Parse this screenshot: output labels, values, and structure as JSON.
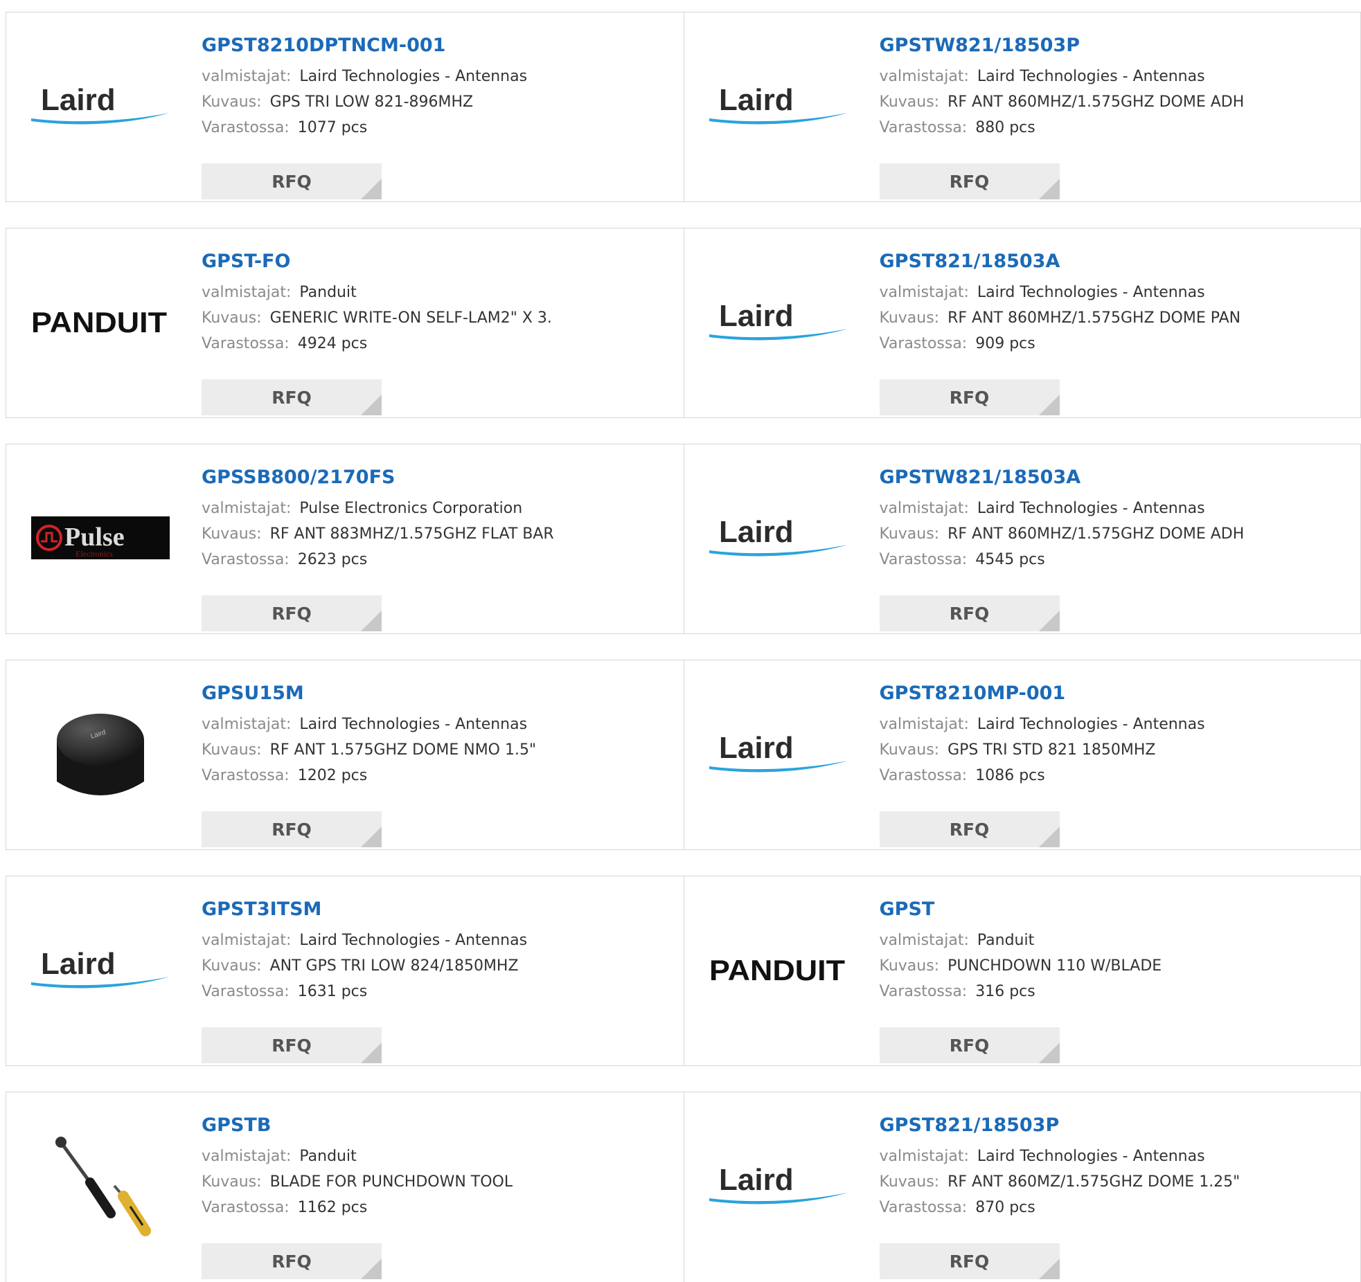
{
  "labels": {
    "manufacturer": "valmistajat:",
    "description": "Kuvaus:",
    "stock": "Varastossa:",
    "rfq": "RFQ"
  },
  "logo_text": {
    "laird": "Laird",
    "panduit": "PANDUIT",
    "pulse": "Pulse",
    "pulse_sub": "Electronics"
  },
  "colors": {
    "link": "#1b6ab8",
    "label": "#8a8a8a",
    "button_bg": "#ececec"
  },
  "products": [
    {
      "pn": "GPST8210DPTNCM-001",
      "logo": "laird-logo",
      "mfr": "Laird Technologies - Antennas",
      "desc": "GPS TRI LOW 821-896MHZ",
      "stock": "1077 pcs"
    },
    {
      "pn": "GPSTW821/18503P",
      "logo": "laird-logo",
      "mfr": "Laird Technologies - Antennas",
      "desc": "RF ANT 860MHZ/1.575GHZ DOME ADH",
      "stock": "880 pcs"
    },
    {
      "pn": "GPST-FO",
      "logo": "panduit-logo",
      "mfr": "Panduit",
      "desc": "GENERIC WRITE-ON SELF-LAM2\" X 3.",
      "stock": "4924 pcs"
    },
    {
      "pn": "GPST821/18503A",
      "logo": "laird-logo",
      "mfr": "Laird Technologies - Antennas",
      "desc": "RF ANT 860MHZ/1.575GHZ DOME PAN",
      "stock": "909 pcs"
    },
    {
      "pn": "GPSSB800/2170FS",
      "logo": "pulse-logo",
      "mfr": "Pulse Electronics Corporation",
      "desc": "RF ANT 883MHZ/1.575GHZ FLAT BAR",
      "stock": "2623 pcs"
    },
    {
      "pn": "GPSTW821/18503A",
      "logo": "laird-logo",
      "mfr": "Laird Technologies - Antennas",
      "desc": "RF ANT 860MHZ/1.575GHZ DOME ADH",
      "stock": "4545 pcs"
    },
    {
      "pn": "GPSU15M",
      "logo": "antenna-dome-photo",
      "mfr": "Laird Technologies - Antennas",
      "desc": "RF ANT 1.575GHZ DOME NMO 1.5\"",
      "stock": "1202 pcs"
    },
    {
      "pn": "GPST8210MP-001",
      "logo": "laird-logo",
      "mfr": "Laird Technologies - Antennas",
      "desc": "GPS TRI STD 821 1850MHZ",
      "stock": "1086 pcs"
    },
    {
      "pn": "GPST3ITSM",
      "logo": "laird-logo",
      "mfr": "Laird Technologies - Antennas",
      "desc": "ANT GPS TRI LOW 824/1850MHZ",
      "stock": "1631 pcs"
    },
    {
      "pn": "GPST",
      "logo": "panduit-logo",
      "mfr": "Panduit",
      "desc": "PUNCHDOWN 110 W/BLADE",
      "stock": "316 pcs"
    },
    {
      "pn": "GPSTB",
      "logo": "punchdown-tool-photo",
      "mfr": "Panduit",
      "desc": "BLADE FOR PUNCHDOWN TOOL",
      "stock": "1162 pcs"
    },
    {
      "pn": "GPST821/18503P",
      "logo": "laird-logo",
      "mfr": "Laird Technologies - Antennas",
      "desc": "RF ANT 860MZ/1.575GHZ DOME 1.25\"",
      "stock": "870 pcs"
    }
  ]
}
